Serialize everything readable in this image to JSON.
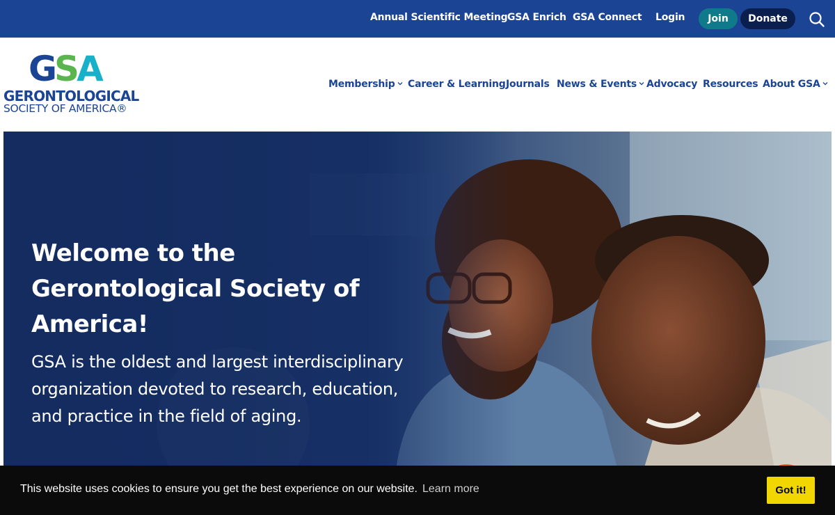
{
  "topbar": {
    "links": [
      "Annual Scientific Meeting",
      "GSA Enrich",
      "GSA Connect",
      "Login"
    ],
    "join_label": "Join",
    "donate_label": "Donate",
    "search_icon": "search-icon"
  },
  "logo": {
    "mark_g": "G",
    "mark_s": "S",
    "mark_a": "A",
    "line1": "GERONTOLOGICAL",
    "line2": "SOCIETY OF AMERICA®"
  },
  "nav": {
    "items": [
      {
        "label": "Membership",
        "has_dropdown": true
      },
      {
        "label": "Career & Learning",
        "has_dropdown": false
      },
      {
        "label": "Journals",
        "has_dropdown": false
      },
      {
        "label": "News & Events",
        "has_dropdown": true
      },
      {
        "label": "Advocacy",
        "has_dropdown": false
      },
      {
        "label": "Resources",
        "has_dropdown": false
      },
      {
        "label": "About GSA",
        "has_dropdown": true
      }
    ]
  },
  "hero": {
    "title": "Welcome to the Gerontological Society of America!",
    "description": "GSA is the oldest and largest interdisciplinary organization devoted to research, education, and practice in the field of aging."
  },
  "cookie": {
    "message": "This website uses cookies to ensure you get the best experience on our website.",
    "learn_more": "Learn more",
    "accept_label": "Got it!"
  },
  "colors": {
    "brand_blue": "#1b4495",
    "join_teal": "#0f7a8a",
    "donate_navy": "#0b1f4f",
    "logo_green": "#5bb54e",
    "logo_cyan": "#19b1c9",
    "cookie_button": "#f1d600"
  }
}
